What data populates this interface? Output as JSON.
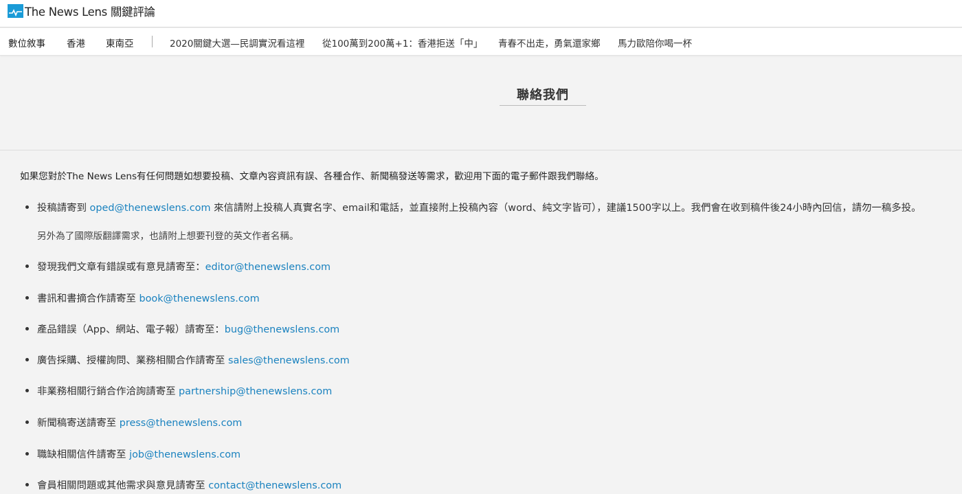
{
  "header": {
    "logo_text": "The News Lens 關鍵評論"
  },
  "nav": {
    "items": [
      "數位敘事",
      "香港",
      "東南亞"
    ],
    "tags": [
      "2020關鍵大選—民調實況看這裡",
      "從100萬到200萬+1：香港拒送「中」",
      "青春不出走，勇氣還家鄉",
      "馬力歐陪你喝一杯"
    ]
  },
  "page": {
    "title": "聯絡我們",
    "intro": "如果您對於The News Lens有任何問題如想要投稿、文章內容資訊有誤、各種合作、新聞稿發送等需求，歡迎用下面的電子郵件跟我們聯絡。"
  },
  "contacts": [
    {
      "pre": "投稿請寄到 ",
      "email": "oped@thenewslens.com",
      "post": " 來信請附上投稿人真實名字、email和電話，並直接附上投稿內容（word、純文字皆可），建議1500字以上。我們會在收到稿件後24小時內回信，請勿一稿多投。"
    },
    {
      "pre": "發現我們文章有錯誤或有意見請寄至：",
      "email": "editor@thenewslens.com",
      "post": ""
    },
    {
      "pre": "書訊和書摘合作請寄至 ",
      "email": "book@thenewslens.com",
      "post": ""
    },
    {
      "pre": "產品錯誤（App、網站、電子報）請寄至：",
      "email": "bug@thenewslens.com",
      "post": ""
    },
    {
      "pre": "廣告採購、授權詢問、業務相關合作請寄至 ",
      "email": "sales@thenewslens.com",
      "post": ""
    },
    {
      "pre": "非業務相關行銷合作洽詢請寄至  ",
      "email": "partnership@thenewslens.com",
      "post": ""
    },
    {
      "pre": "新聞稿寄送請寄至 ",
      "email": "press@thenewslens.com",
      "post": ""
    },
    {
      "pre": "職缺相關信件請寄至 ",
      "email": "job@thenewslens.com",
      "post": ""
    },
    {
      "pre": "會員相關問題或其他需求與意見請寄至 ",
      "email": "contact@thenewslens.com",
      "post": ""
    }
  ],
  "contact_note": "另外為了國際版翻譯需求，也請附上想要刊登的英文作者名稱。",
  "colors": {
    "brand": "#1a9bd7",
    "link": "#1a82bf",
    "background": "#f3f3f3"
  },
  "icons": {
    "logo": "newslens-logo-icon"
  }
}
